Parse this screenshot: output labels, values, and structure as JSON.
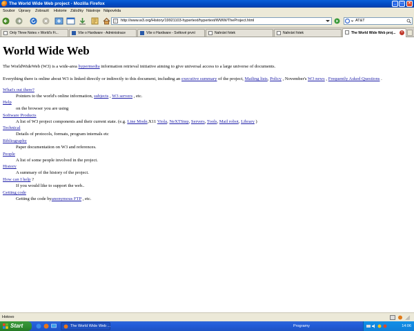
{
  "window": {
    "title": "The World Wide Web project - Mozilla Firefox"
  },
  "menu": [
    "Soubor",
    "Úpravy",
    "Zobrazit",
    "Historie",
    "Záložky",
    "Nástroje",
    "Nápověda"
  ],
  "nav": {
    "url": "http://www.w3.org/History/19921103-hypertext/hypertext/WWW/TheProject.html",
    "search_text": "AT&T"
  },
  "tabs": [
    {
      "label": "Only Three Notes » World's Fi..."
    },
    {
      "label": "Vše o Hardware - Administrace"
    },
    {
      "label": "Vše o Hardware - Světové první"
    },
    {
      "label": "Nahrání fotek"
    },
    {
      "label": "Nahrání fotek"
    },
    {
      "label": "The World Wide Web proj..."
    }
  ],
  "page": {
    "heading": "World Wide Web",
    "intro": {
      "t1": "The WorldWideWeb (W3) is a wide-area",
      "l1": "hypermedia",
      "t2": "information retrieval initiative aiming to give universal access to a large universe of documents."
    },
    "summary": {
      "t1": "Everything there is online about W3 is linked directly or indirectly to this document, including an",
      "l1": "executive summary",
      "t2": "of the project,",
      "l2": "Mailing lists",
      "t3": ",",
      "l3": "Policy",
      "t4": ", November's",
      "l4": "W3 news",
      "t5": ",",
      "l5": "Frequently Asked Questions",
      "t6": "."
    },
    "items": {
      "whats_out": {
        "title": "What's out there?",
        "t1": "Pointers to the world's online information,",
        "l1": "subjects",
        "t2": ",",
        "l2": "W3 servers",
        "t3": ", etc."
      },
      "help": {
        "title": "Help",
        "desc": "on the browser you are using"
      },
      "software": {
        "title": "Software Products",
        "t1": "A list of W3 project components and their current state. (e.g.",
        "l1": "Line Mode",
        "t2": ",X11",
        "l2": "Viola",
        "t3": ",",
        "l3": "NeXTStep",
        "t4": ",",
        "l4": "Servers",
        "t5": ",",
        "l5": "Tools",
        "t6": ",",
        "l6": "Mail robot",
        "t7": ",",
        "l7": "Library",
        "t8": ")"
      },
      "technical": {
        "title": "Technical",
        "desc": "Details of protocols, formats, program internals etc"
      },
      "bibliography": {
        "title": "Bibliography",
        "desc": "Paper documentation on W3 and references."
      },
      "people": {
        "title": "People",
        "desc": "A list of some people involved in the project."
      },
      "history": {
        "title": "History",
        "desc": "A summary of the history of the project."
      },
      "help_out": {
        "title": "How can I help",
        "suffix": "?",
        "desc": "If you would like to support the web.."
      },
      "getting_code": {
        "title": "Getting code",
        "t1": "Getting the code by",
        "l1": "anonymous FTP",
        "t2": ", etc."
      }
    }
  },
  "status": {
    "text": "Hotovo"
  },
  "taskbar": {
    "start_label": "Start",
    "task_label": "The World Wide Web ...",
    "programs_label": "Programy",
    "clock": "14:06"
  },
  "colors": {
    "link": "#1a1aa6",
    "titlebar": "#0a5fd8",
    "chrome": "#ece9d8",
    "start": "#2f8a2f"
  }
}
